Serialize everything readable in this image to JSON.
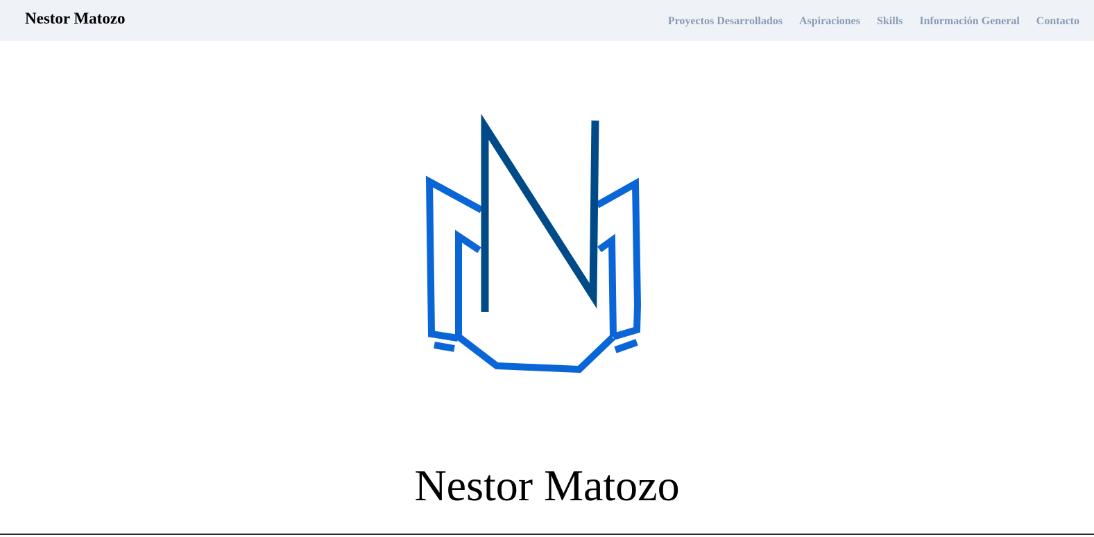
{
  "navbar": {
    "brand": "Nestor Matozo",
    "links": [
      {
        "label": "Proyectos Desarrollados"
      },
      {
        "label": "Aspiraciones"
      },
      {
        "label": "Skills"
      },
      {
        "label": "Información General"
      },
      {
        "label": "Contacto"
      }
    ]
  },
  "hero": {
    "logo": {
      "icon": "nm-monogram-logo",
      "colors": {
        "dark_blue": "#004b87",
        "bright_blue": "#0a66d6"
      }
    },
    "name": "Nestor Matozo"
  },
  "colors": {
    "navbar_bg": "#eff3f8",
    "nav_link": "#8a9bb5",
    "text": "#000000",
    "background": "#ffffff"
  }
}
